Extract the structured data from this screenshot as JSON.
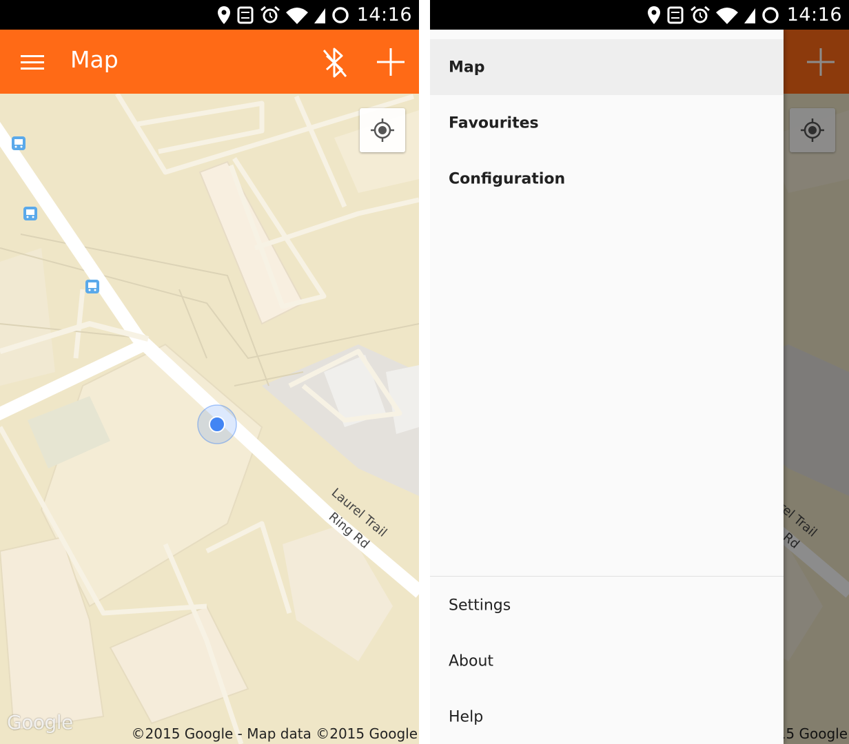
{
  "status_bar": {
    "time": "14:16"
  },
  "app_bar": {
    "title": "Map"
  },
  "map": {
    "street_labels": [
      "Laurel Trail",
      "Ring Rd"
    ],
    "google_logo": "Google",
    "copyright": "©2015 Google - Map data ©2015 Google"
  },
  "drawer": {
    "primary_items": [
      {
        "label": "Map",
        "active": true
      },
      {
        "label": "Favourites",
        "active": false
      },
      {
        "label": "Configuration",
        "active": false
      }
    ],
    "secondary_items": [
      {
        "label": "Settings"
      },
      {
        "label": "About"
      },
      {
        "label": "Help"
      }
    ]
  },
  "colors": {
    "accent": "#ff6a16",
    "map_land": "#efe6c7",
    "location_dot": "#4285f4",
    "bus_stop": "#5aa9ea"
  },
  "icons": [
    "location-pin-icon",
    "sync-icon",
    "alarm-icon",
    "wifi-icon",
    "signal-icon",
    "battery-icon",
    "menu-icon",
    "bluetooth-icon",
    "add-icon",
    "my-location-icon",
    "bus-stop-icon"
  ]
}
